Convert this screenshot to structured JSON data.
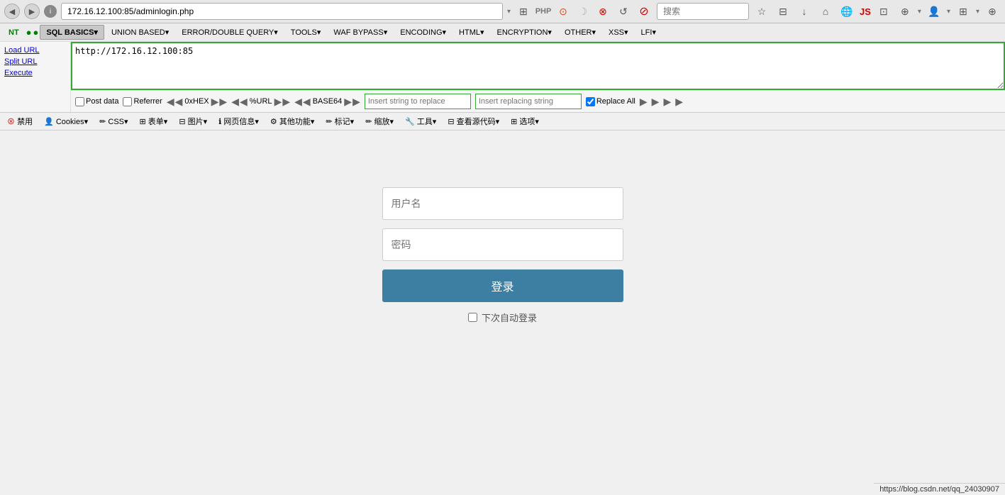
{
  "browser": {
    "address": "172.16.12.100:85/adminlogin.php",
    "full_url": "http://172.16.12.100:85/adminlogin.php",
    "search_placeholder": "搜索",
    "back_icon": "◀",
    "forward_icon": "▶",
    "reload_icon": "↺",
    "home_icon": "⌂",
    "info_icon": "i"
  },
  "hackbar": {
    "menu_items": [
      {
        "label": "NT",
        "id": "nt"
      },
      {
        "label": "SQL BASICS▾",
        "id": "sql-basics"
      },
      {
        "label": "UNION BASED▾",
        "id": "union-based"
      },
      {
        "label": "ERROR/DOUBLE QUERY▾",
        "id": "error-double"
      },
      {
        "label": "TOOLS▾",
        "id": "tools"
      },
      {
        "label": "WAF BYPASS▾",
        "id": "waf-bypass"
      },
      {
        "label": "ENCODING▾",
        "id": "encoding"
      },
      {
        "label": "HTML▾",
        "id": "html"
      },
      {
        "label": "ENCRYPTION▾",
        "id": "encryption"
      },
      {
        "label": "OTHER▾",
        "id": "other"
      },
      {
        "label": "XSS▾",
        "id": "xss"
      },
      {
        "label": "LFI▾",
        "id": "lfi"
      }
    ],
    "sidebar_buttons": [
      {
        "label": "Load URL",
        "id": "load-url"
      },
      {
        "label": "Split URL",
        "id": "split-url"
      },
      {
        "label": "Execute",
        "id": "execute"
      }
    ],
    "url_value": "http://172.16.12.100:85",
    "options": {
      "post_data": "Post data",
      "referrer": "Referrer",
      "hex_encode": "0xHEX",
      "url_encode": "%URL",
      "base64_encode": "BASE64",
      "replace_all": "Replace All",
      "insert_string_to_replace_placeholder": "Insert string to replace",
      "insert_replacing_string_placeholder": "Insert replacing string"
    }
  },
  "firebug": {
    "buttons": [
      {
        "label": "禁用",
        "id": "disable-btn"
      },
      {
        "label": "Cookies▾",
        "id": "cookies-btn"
      },
      {
        "label": "CSS▾",
        "id": "css-btn"
      },
      {
        "label": "表单▾",
        "id": "forms-btn"
      },
      {
        "label": "图片▾",
        "id": "images-btn"
      },
      {
        "label": "网页信息▾",
        "id": "page-info-btn"
      },
      {
        "label": "其他功能▾",
        "id": "other-func-btn"
      },
      {
        "label": "标记▾",
        "id": "mark-btn"
      },
      {
        "label": "缩放▾",
        "id": "zoom-btn"
      },
      {
        "label": "工具▾",
        "id": "tools-btn"
      },
      {
        "label": "查看源代码▾",
        "id": "source-btn"
      },
      {
        "label": "选项▾",
        "id": "options-btn"
      }
    ]
  },
  "login_form": {
    "username_placeholder": "用户名",
    "password_placeholder": "密码",
    "login_button": "登录",
    "remember_label": "下次自动登录"
  },
  "status_bar": {
    "text": "https://blog.csdn.net/qq_24030907"
  }
}
